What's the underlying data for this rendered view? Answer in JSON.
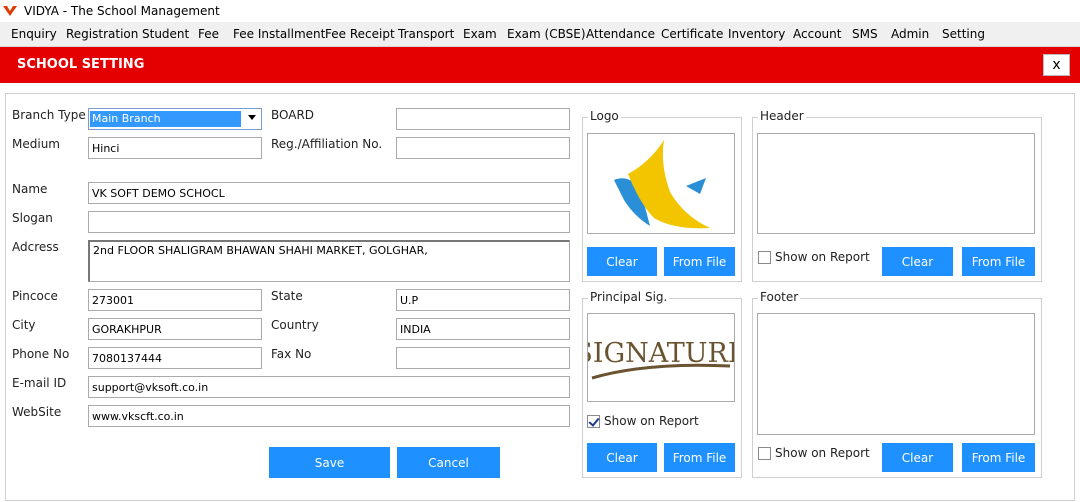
{
  "app": {
    "title": "VIDYA - The School Management"
  },
  "menu": [
    "Enquiry",
    "Registration",
    "Student",
    "Fee",
    "Fee Installment",
    "Fee Receipt",
    "Transport",
    "Exam",
    "Exam (CBSE)",
    "Attendance",
    "Certificate",
    "Inventory",
    "Account",
    "SMS",
    "Admin",
    "Setting"
  ],
  "page": {
    "heading": "SCHOOL SETTING",
    "close": "x"
  },
  "form": {
    "branch_type": {
      "label": "Branch Type",
      "value": "Main Branch"
    },
    "board": {
      "label": "BOARD",
      "value": ""
    },
    "medium": {
      "label": "Medium",
      "value": "Hinci"
    },
    "reg": {
      "label": "Reg./Affiliation No.",
      "value": ""
    },
    "name": {
      "label": "Name",
      "value": "VK SOFT DEMO SCHOCL"
    },
    "slogan": {
      "label": "Slogan",
      "value": ""
    },
    "address": {
      "label": "Adcress",
      "value": "2nd FLOOR SHALIGRAM BHAWAN SHAHI MARKET, GOLGHAR,"
    },
    "pincode": {
      "label": "Pincoce",
      "value": "273001"
    },
    "state": {
      "label": "State",
      "value": "U.P"
    },
    "city": {
      "label": "City",
      "value": "GORAKHPUR"
    },
    "country": {
      "label": "Country",
      "value": "INDIA"
    },
    "phone": {
      "label": "Phone  No",
      "value": "7080137444"
    },
    "fax": {
      "label": "Fax No",
      "value": ""
    },
    "email": {
      "label": "E-mail ID",
      "value": "support@vksoft.co.in"
    },
    "website": {
      "label": "WebSite",
      "value": "www.vkscft.co.in"
    },
    "save": "Save",
    "cancel": "Cancel"
  },
  "logo": {
    "title": "Logo",
    "clear": "Clear",
    "from_file": "From File",
    "brand_colors": [
      "#f2c500",
      "#2a8fd6"
    ]
  },
  "header": {
    "title": "Header",
    "show_on_report": "Show on Report",
    "checked": false,
    "clear": "Clear",
    "from_file": "From File"
  },
  "principal_sig": {
    "title": "Principal Sig.",
    "signature_text": "SIGNATURE",
    "show_on_report": "Show on Report",
    "checked": true,
    "clear": "Clear",
    "from_file": "From File"
  },
  "footer": {
    "title": "Footer",
    "show_on_report": "Show on Report",
    "checked": false,
    "clear": "Clear",
    "from_file": "From File"
  }
}
